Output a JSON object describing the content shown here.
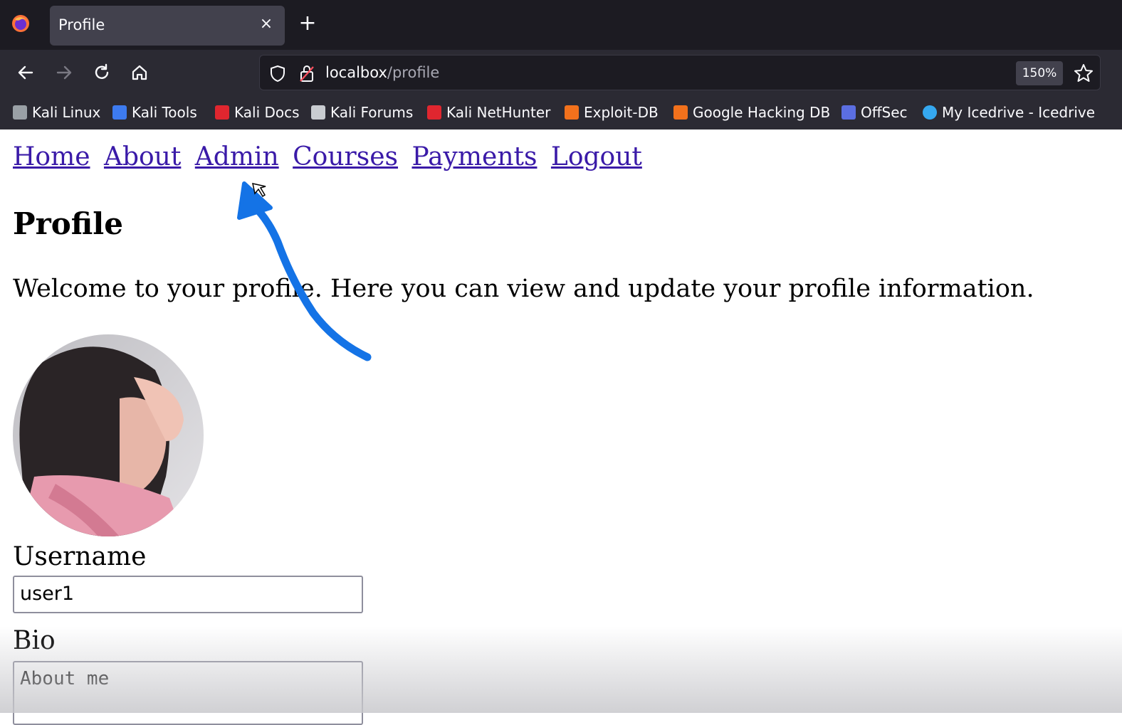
{
  "browser": {
    "tab_title": "Profile",
    "tab_close_glyph": "×",
    "new_tab_glyph": "+",
    "url_host": "localbox",
    "url_path": "/profile",
    "zoom": "150%",
    "bookmarks": [
      {
        "label": "Kali Linux",
        "icon": "kali-dragon-icon",
        "color": "#9aa0a6"
      },
      {
        "label": "Kali Tools",
        "icon": "kali-tools-icon",
        "color": "#3d7bf0"
      },
      {
        "label": "Kali Docs",
        "icon": "kali-docs-icon",
        "color": "#e0262f"
      },
      {
        "label": "Kali Forums",
        "icon": "kali-forums-icon",
        "color": "#c9ccd1"
      },
      {
        "label": "Kali NetHunter",
        "icon": "nethunter-icon",
        "color": "#e0262f"
      },
      {
        "label": "Exploit-DB",
        "icon": "exploit-db-icon",
        "color": "#f2711c"
      },
      {
        "label": "Google Hacking DB",
        "icon": "ghdb-icon",
        "color": "#f2711c"
      },
      {
        "label": "OffSec",
        "icon": "offsec-icon",
        "color": "#5b6ee1"
      },
      {
        "label": "My Icedrive - Icedrive",
        "icon": "icedrive-icon",
        "color": "#35a8f0"
      }
    ]
  },
  "site_nav": {
    "items": [
      "Home",
      "About",
      "Admin",
      "Courses",
      "Payments",
      "Logout"
    ]
  },
  "page": {
    "title": "Profile",
    "intro": "Welcome to your profile. Here you can view and update your profile information.",
    "username_label": "Username",
    "username_value": "user1",
    "bio_label": "Bio",
    "bio_value": "About me"
  },
  "colors": {
    "link": "#3a1aa8",
    "annotation_arrow": "#1473e6",
    "chrome_dark": "#1c1b22",
    "chrome_mid": "#2b2a33"
  }
}
